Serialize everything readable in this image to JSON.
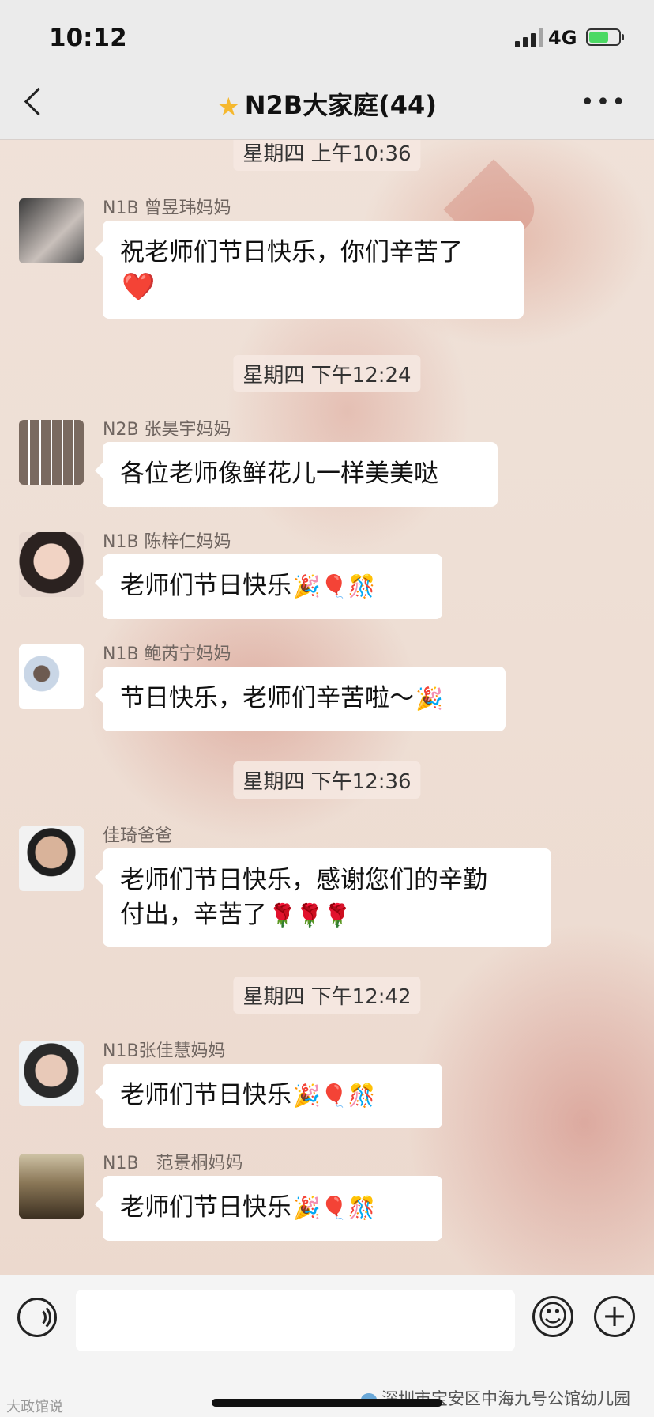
{
  "status_bar": {
    "time": "10:12",
    "network": "4G"
  },
  "nav": {
    "title": "N2B大家庭(44)",
    "star_icon": "star-icon"
  },
  "messages_timestamps": [
    "星期四 上午10:36",
    "星期四 下午12:24",
    "星期四 下午12:36",
    "星期四 下午12:42"
  ],
  "messages": [
    {
      "sender": "N1B 曾昱玮妈妈",
      "text": "祝老师们节日快乐，你们辛苦了",
      "emoji": "❤️"
    },
    {
      "sender": "N2B 张昊宇妈妈",
      "text": "各位老师像鲜花儿一样美美哒",
      "emoji": ""
    },
    {
      "sender": "N1B 陈梓仁妈妈",
      "text": "老师们节日快乐",
      "emoji": "🎉🎈🎊"
    },
    {
      "sender": "N1B 鲍芮宁妈妈",
      "text": "节日快乐，老师们辛苦啦～",
      "emoji": "🎉"
    },
    {
      "sender": "佳琦爸爸",
      "text_line1": "老师们节日快乐，感谢您们的辛勤",
      "text_line2": "付出，辛苦了",
      "emoji": "🌹🌹🌹"
    },
    {
      "sender": "N1B张佳慧妈妈",
      "text": "老师们节日快乐",
      "emoji": "🎉🎈🎊"
    },
    {
      "sender": "N1B　范景桐妈妈",
      "text": "老师们节日快乐",
      "emoji": "🎉🎈🎊"
    }
  ],
  "input_bar": {
    "voice_icon": "voice-icon",
    "emoji_icon": "emoji-icon",
    "plus_icon": "plus-icon"
  },
  "watermark": {
    "left": "大政馆说",
    "right": "深圳市宝安区中海九号公馆幼儿园"
  }
}
